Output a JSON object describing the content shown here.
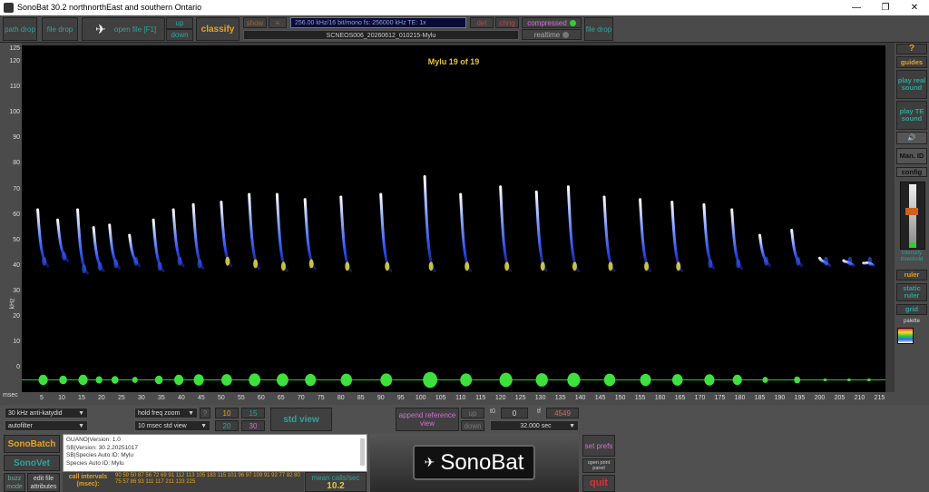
{
  "window": {
    "title": "SonoBat 30.2 northnorthEast and southern Ontario",
    "min": "—",
    "restore": "❐",
    "close": "✕"
  },
  "toolbar": {
    "path_drop": "path drop",
    "file_drop": "file drop",
    "open_file": "open file [F1]",
    "up": "up",
    "down": "down",
    "classify": "classify",
    "show": "show",
    "info_line": "256.00 kHz/16 bit/mono  fs: 256000 kHz  TE: 1x",
    "det": "det",
    "chng": "chng",
    "compressed": "compressed",
    "realtime": "realtime",
    "file_drop2": "file drop",
    "filename": "SCNEOS006_20260612_010215-Mylu"
  },
  "spectrogram": {
    "label": "Mylu  19 of 19",
    "ylabel": "kHz",
    "yticks": [
      "125",
      "120",
      "110",
      "100",
      "90",
      "80",
      "70",
      "60",
      "50",
      "40",
      "30",
      "20",
      "10",
      "0"
    ],
    "xlabel": "msec",
    "xticks": [
      "5",
      "10",
      "15",
      "20",
      "25",
      "30",
      "35",
      "40",
      "45",
      "50",
      "55",
      "60",
      "65",
      "70",
      "75",
      "80",
      "85",
      "90",
      "95",
      "100",
      "105",
      "110",
      "115",
      "120",
      "125",
      "130",
      "135",
      "140",
      "145",
      "150",
      "155",
      "160",
      "165",
      "170",
      "175",
      "180",
      "185",
      "190",
      "195",
      "200",
      "205",
      "210",
      "215"
    ]
  },
  "right": {
    "help": "?",
    "guides": "guides",
    "play_real": "play real sound",
    "play_te": "play TE sound",
    "man_id": "Man. ID",
    "config": "config",
    "intensity": "intensity threshold",
    "ruler": "ruler",
    "static_ruler": "static ruler",
    "grid": "grid",
    "palette": "palette"
  },
  "bottom": {
    "antikatydid": "30 kHz anti-katydid",
    "autofilter": "autofilter",
    "hold_freq": "hold freq zoom",
    "std_sel": "10 msec std view",
    "n10": "10",
    "n15": "15",
    "n20": "20",
    "n30": "30",
    "std_view": "std view",
    "append": "append reference view",
    "up": "up",
    "down": "down",
    "t0": "t0",
    "t0_val": "0",
    "tf": "tf",
    "tf_val": "4549",
    "duration": "32.000 sec",
    "sonobatch": "SonoBatch",
    "sonovet": "SonoVet",
    "buzz": "buzz mode",
    "edit_file": "edit file attributes",
    "call_intervals_label": "call intervals (msec):",
    "call_intervals": "90 59 50 87 56 72 69 91 112 113 105 183 115 101 96 97 109 91 92 77 82 80 75 57 86 93 111 117 211 133 225",
    "mean_label": "mean calls/sec",
    "mean_val": "10.2",
    "set_prefs": "set prefs",
    "open_print": "open print panel",
    "quit": "quit",
    "logo": "SonoBat"
  },
  "info": [
    "GUANO|Version:  1.0",
    "SB|Version:  30.2.20251017",
    "SB|Species Auto ID:  Mylu",
    "Species Auto ID:  Mylu"
  ],
  "calls": [
    {
      "t": 4,
      "top": 62,
      "bot": 40
    },
    {
      "t": 9,
      "top": 58,
      "bot": 42
    },
    {
      "t": 14,
      "top": 62,
      "bot": 37
    },
    {
      "t": 18,
      "top": 55,
      "bot": 38
    },
    {
      "t": 22,
      "top": 56,
      "bot": 39
    },
    {
      "t": 27,
      "top": 52,
      "bot": 40
    },
    {
      "t": 33,
      "top": 58,
      "bot": 38
    },
    {
      "t": 38,
      "top": 62,
      "bot": 40
    },
    {
      "t": 43,
      "top": 64,
      "bot": 39
    },
    {
      "t": 50,
      "top": 65,
      "bot": 40
    },
    {
      "t": 57,
      "top": 68,
      "bot": 39
    },
    {
      "t": 64,
      "top": 68,
      "bot": 38
    },
    {
      "t": 71,
      "top": 66,
      "bot": 39
    },
    {
      "t": 80,
      "top": 67,
      "bot": 38
    },
    {
      "t": 90,
      "top": 68,
      "bot": 38
    },
    {
      "t": 101,
      "top": 75,
      "bot": 38
    },
    {
      "t": 110,
      "top": 68,
      "bot": 38
    },
    {
      "t": 120,
      "top": 71,
      "bot": 38
    },
    {
      "t": 129,
      "top": 69,
      "bot": 38
    },
    {
      "t": 137,
      "top": 71,
      "bot": 38
    },
    {
      "t": 146,
      "top": 67,
      "bot": 38
    },
    {
      "t": 155,
      "top": 66,
      "bot": 38
    },
    {
      "t": 163,
      "top": 65,
      "bot": 38
    },
    {
      "t": 171,
      "top": 64,
      "bot": 39
    },
    {
      "t": 178,
      "top": 62,
      "bot": 39
    },
    {
      "t": 185,
      "top": 52,
      "bot": 40
    },
    {
      "t": 193,
      "top": 54,
      "bot": 40
    },
    {
      "t": 200,
      "top": 43,
      "bot": 40
    },
    {
      "t": 206,
      "top": 42,
      "bot": 40
    },
    {
      "t": 211,
      "top": 41,
      "bot": 40
    }
  ]
}
